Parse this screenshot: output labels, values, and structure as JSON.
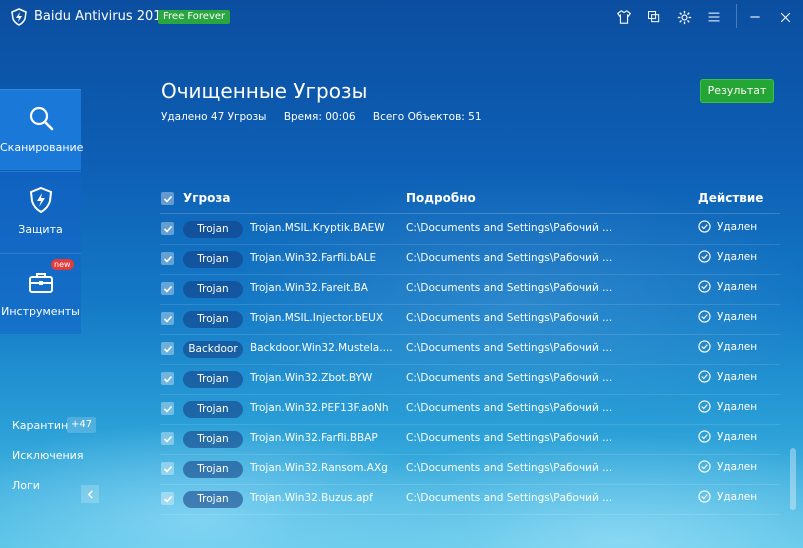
{
  "app": {
    "title": "Baidu Antivirus 2015",
    "badge": "Free Forever"
  },
  "titlebar": {
    "icons": [
      "shirt-icon",
      "window-icon",
      "gear-icon",
      "menu-icon",
      "minimize-icon",
      "close-icon"
    ]
  },
  "sidebar": {
    "items": [
      {
        "label": "Сканирование",
        "icon": "search-icon",
        "active": true
      },
      {
        "label": "Защита",
        "icon": "shield-icon",
        "active": false
      },
      {
        "label": "Инструменты",
        "icon": "toolbox-icon",
        "active": false,
        "badge": "new"
      }
    ],
    "links": [
      {
        "label": "Карантин",
        "count": "+47"
      },
      {
        "label": "Исключения"
      },
      {
        "label": "Логи"
      }
    ]
  },
  "header": {
    "title": "Очищенные Угрозы",
    "removed": "Удалено 47 Угрозы",
    "time": "Время: 00:06",
    "total": "Всего Объектов:  51",
    "result_button": "Результат"
  },
  "table": {
    "columns": {
      "threat": "Угроза",
      "details": "Подробно",
      "action": "Действие"
    },
    "rows": [
      {
        "type": "Trojan",
        "name": "Trojan.MSIL.Kryptik.BAEW",
        "detail": "C:\\Documents and Settings\\Рабочий ...",
        "status": "Удален"
      },
      {
        "type": "Trojan",
        "name": "Trojan.Win32.Farfli.bALE",
        "detail": "C:\\Documents and Settings\\Рабочий ...",
        "status": "Удален"
      },
      {
        "type": "Trojan",
        "name": "Trojan.Win32.Fareit.BA",
        "detail": "C:\\Documents and Settings\\Рабочий ...",
        "status": "Удален"
      },
      {
        "type": "Trojan",
        "name": "Trojan.MSIL.Injector.bEUX",
        "detail": "C:\\Documents and Settings\\Рабочий ...",
        "status": "Удален"
      },
      {
        "type": "Backdoor",
        "name": "Backdoor.Win32.Mustela....",
        "detail": "C:\\Documents and Settings\\Рабочий ...",
        "status": "Удален"
      },
      {
        "type": "Trojan",
        "name": "Trojan.Win32.Zbot.BYW",
        "detail": "C:\\Documents and Settings\\Рабочий ...",
        "status": "Удален"
      },
      {
        "type": "Trojan",
        "name": "Trojan.Win32.PEF13F.aoNh",
        "detail": "C:\\Documents and Settings\\Рабочий ...",
        "status": "Удален"
      },
      {
        "type": "Trojan",
        "name": "Trojan.Win32.Farfli.BBAP",
        "detail": "C:\\Documents and Settings\\Рабочий ...",
        "status": "Удален"
      },
      {
        "type": "Trojan",
        "name": "Trojan.Win32.Ransom.AXg",
        "detail": "C:\\Documents and Settings\\Рабочий ...",
        "status": "Удален"
      },
      {
        "type": "Trojan",
        "name": "Trojan.Win32.Buzus.apf",
        "detail": "C:\\Documents and Settings\\Рабочий ...",
        "status": "Удален"
      }
    ]
  }
}
